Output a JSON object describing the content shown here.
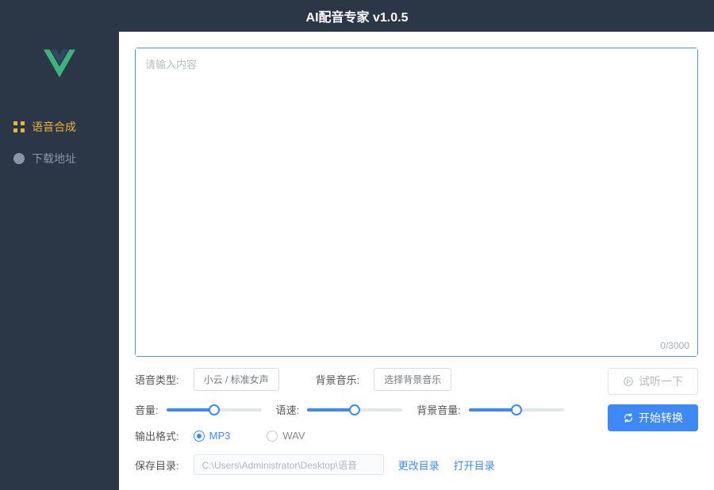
{
  "title": "AI配音专家 v1.0.5",
  "sidebar": {
    "items": [
      {
        "label": "语音合成"
      },
      {
        "label": "下载地址"
      }
    ]
  },
  "textarea": {
    "placeholder": "请输入内容",
    "value": "",
    "counter": "0/3000"
  },
  "voiceType": {
    "label": "语音类型:",
    "value": "小云 / 标准女声"
  },
  "bgm": {
    "label": "背景音乐:",
    "value": "选择背景音乐"
  },
  "sliders": {
    "volume": {
      "label": "音量:",
      "pct": 50
    },
    "speed": {
      "label": "语速:",
      "pct": 50
    },
    "bgmVolume": {
      "label": "背景音量:",
      "pct": 50
    }
  },
  "outputFormat": {
    "label": "输出格式:",
    "options": [
      {
        "label": "MP3",
        "selected": true
      },
      {
        "label": "WAV",
        "selected": false
      }
    ]
  },
  "saveDir": {
    "label": "保存目录:",
    "value": "C:\\Users\\Administrator\\Desktop\\语音",
    "changeLabel": "更改目录",
    "openLabel": "打开目录"
  },
  "actions": {
    "preview": "试听一下",
    "convert": "开始转换"
  },
  "watermark": ""
}
